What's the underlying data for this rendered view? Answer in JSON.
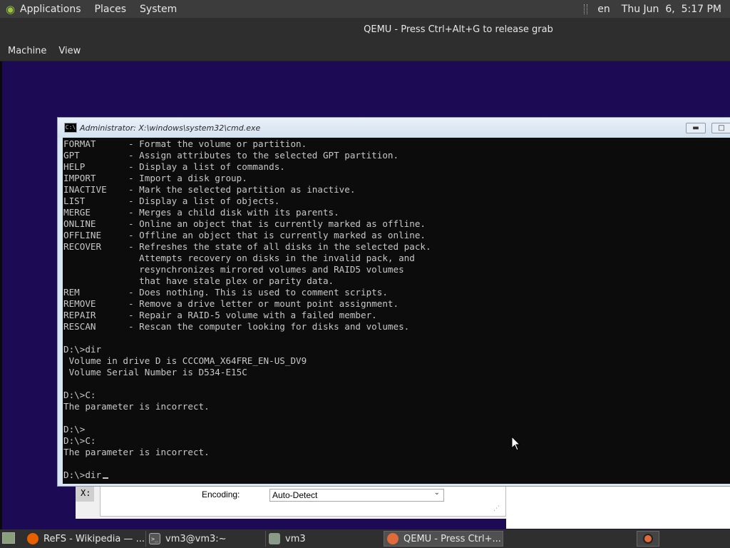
{
  "top_panel": {
    "menus": [
      "Applications",
      "Places",
      "System"
    ],
    "keyboard_layout": "en",
    "clock": "Thu Jun  6,  5:17 PM"
  },
  "qemu": {
    "title": "QEMU - Press Ctrl+Alt+G to release grab",
    "menu": [
      "Machine",
      "View"
    ]
  },
  "background_dialog": {
    "x_label": "X:",
    "encoding_label": "Encoding:",
    "encoding_value": "Auto-Detect"
  },
  "cmd": {
    "title": "Administrator: X:\\windows\\system32\\cmd.exe",
    "lines": [
      "FORMAT      - Format the volume or partition.",
      "GPT         - Assign attributes to the selected GPT partition.",
      "HELP        - Display a list of commands.",
      "IMPORT      - Import a disk group.",
      "INACTIVE    - Mark the selected partition as inactive.",
      "LIST        - Display a list of objects.",
      "MERGE       - Merges a child disk with its parents.",
      "ONLINE      - Online an object that is currently marked as offline.",
      "OFFLINE     - Offline an object that is currently marked as online.",
      "RECOVER     - Refreshes the state of all disks in the selected pack.",
      "              Attempts recovery on disks in the invalid pack, and",
      "              resynchronizes mirrored volumes and RAID5 volumes",
      "              that have stale plex or parity data.",
      "REM         - Does nothing. This is used to comment scripts.",
      "REMOVE      - Remove a drive letter or mount point assignment.",
      "REPAIR      - Repair a RAID-5 volume with a failed member.",
      "RESCAN      - Rescan the computer looking for disks and volumes.",
      "",
      "D:\\>dir",
      " Volume in drive D is CCCOMA_X64FRE_EN-US_DV9",
      " Volume Serial Number is D534-E15C",
      "",
      "D:\\>C:",
      "The parameter is incorrect.",
      "",
      "D:\\>",
      "D:\\>C:",
      "The parameter is incorrect.",
      "",
      "D:\\>dir"
    ]
  },
  "taskbar": {
    "tasks": [
      {
        "label": "ReFS - Wikipedia — ..."
      },
      {
        "label": "vm3@vm3:~"
      },
      {
        "label": "vm3"
      },
      {
        "label": "QEMU - Press Ctrl+..."
      }
    ]
  }
}
